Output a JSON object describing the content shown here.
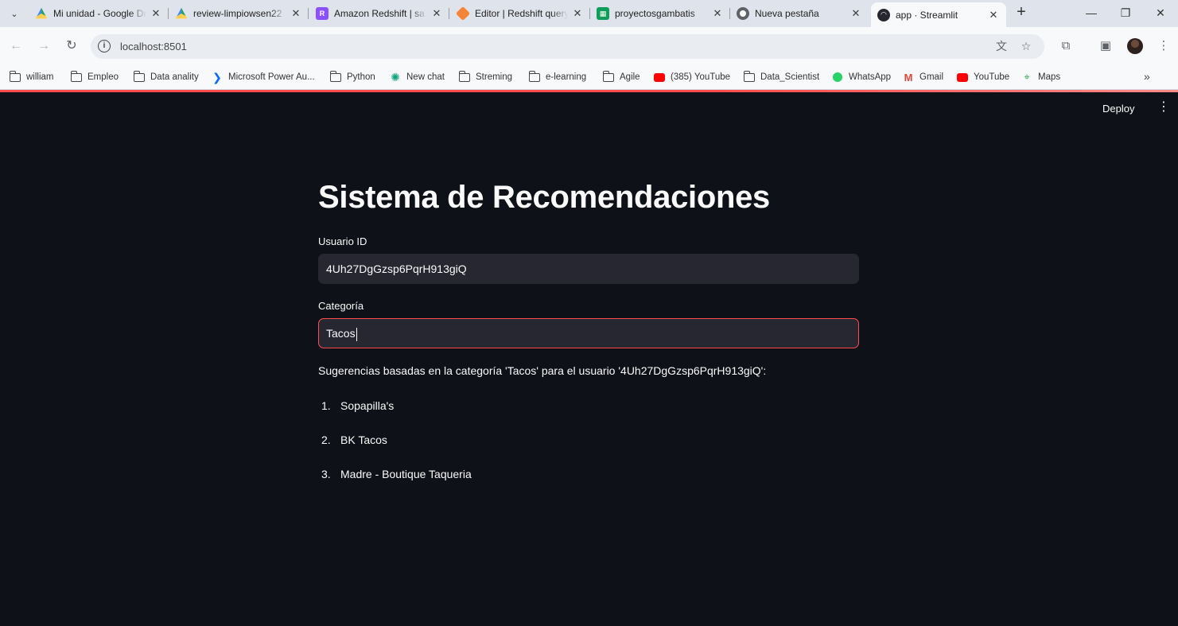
{
  "browser": {
    "tabs": [
      {
        "title": "Mi unidad - Google Drive",
        "favicon": "google-drive-icon",
        "color": "#1fa463"
      },
      {
        "title": "review-limpiowsen22",
        "favicon": "google-drive-icon",
        "color": "#1fa463"
      },
      {
        "title": "Amazon Redshift | sa",
        "favicon": "redshift-icon",
        "color": "#8c4fff"
      },
      {
        "title": "Editor | Redshift query",
        "favicon": "cube-icon",
        "color": "#f58536"
      },
      {
        "title": "proyectosgambatis",
        "favicon": "sheets-icon",
        "color": "#0f9d58"
      },
      {
        "title": "Nueva pestaña",
        "favicon": "chrome-icon",
        "color": "#5f6368"
      },
      {
        "title": "app · Streamlit",
        "favicon": "streamlit-icon",
        "color": "#262730",
        "active": true
      }
    ],
    "url": "localhost:8501",
    "bookmarks": [
      {
        "label": "william",
        "icon": "folder-icon"
      },
      {
        "label": "Empleo",
        "icon": "folder-icon"
      },
      {
        "label": "Data anality",
        "icon": "folder-icon"
      },
      {
        "label": "Microsoft Power Au...",
        "icon": "power-automate-icon",
        "color": "#0066ff"
      },
      {
        "label": "Python",
        "icon": "folder-icon"
      },
      {
        "label": "New chat",
        "icon": "chatgpt-icon",
        "color": "#10a37f"
      },
      {
        "label": "Streming",
        "icon": "folder-icon"
      },
      {
        "label": "e-learning",
        "icon": "folder-icon"
      },
      {
        "label": "Agile",
        "icon": "folder-icon"
      },
      {
        "label": "(385) YouTube",
        "icon": "youtube-icon",
        "color": "#ff0000"
      },
      {
        "label": "Data_Scientist",
        "icon": "folder-icon"
      },
      {
        "label": "WhatsApp",
        "icon": "whatsapp-icon",
        "color": "#25d366"
      },
      {
        "label": "Gmail",
        "icon": "gmail-icon",
        "color": "#ea4335"
      },
      {
        "label": "YouTube",
        "icon": "youtube-icon",
        "color": "#ff0000"
      },
      {
        "label": "Maps",
        "icon": "maps-icon",
        "color": "#34a853"
      }
    ]
  },
  "app": {
    "deploy_label": "Deploy",
    "title": "Sistema de Recomendaciones",
    "user_field": {
      "label": "Usuario ID",
      "value": "4Uh27DgGzsp6PqrH913giQ"
    },
    "category_field": {
      "label": "Categoría",
      "value": "Tacos"
    },
    "result_text": "Sugerencias basadas en la categoría 'Tacos' para el usuario '4Uh27DgGzsp6PqrH913giQ':",
    "recommendations": [
      {
        "num": "1.",
        "name": "Sopapilla's"
      },
      {
        "num": "2.",
        "name": "BK Tacos"
      },
      {
        "num": "3.",
        "name": "Madre - Boutique Taqueria"
      }
    ],
    "accent_color": "#ff4b4b",
    "background_color": "#0e1117",
    "input_color": "#262730"
  }
}
